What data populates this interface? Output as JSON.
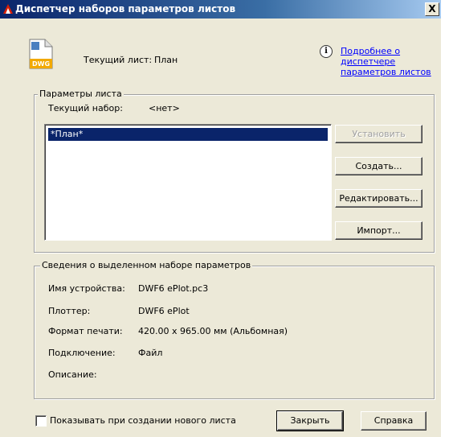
{
  "window": {
    "title": "Диспетчер наборов параметров листов",
    "close_label": "X"
  },
  "header": {
    "current_sheet_label": "Текущий лист:",
    "current_sheet_value": "План",
    "icon_badge": "DWG",
    "info_link_line1": "Подробнее о",
    "info_link_line2": "диспетчере",
    "info_link_line3": "параметров листов"
  },
  "params_group": {
    "legend": "Параметры листа",
    "current_set_label": "Текущий набор:",
    "current_set_value": "<нет>",
    "list_items": [
      "*План*"
    ],
    "buttons": {
      "set": "Установить",
      "create": "Создать...",
      "edit": "Редактировать...",
      "import": "Импорт..."
    }
  },
  "details_group": {
    "legend": "Сведения о выделенном наборе параметров",
    "device_label": "Имя устройства:",
    "device_value": "DWF6 ePlot.pc3",
    "plotter_label": "Плоттер:",
    "plotter_value": "DWF6 ePlot",
    "format_label": "Формат печати:",
    "format_value": "420.00 x 965.00 мм (Альбомная)",
    "connection_label": "Подключение:",
    "connection_value": "Файл",
    "description_label": "Описание:"
  },
  "footer": {
    "checkbox_label": "Показывать при создании нового листа",
    "checkbox_checked": false,
    "close_button": "Закрыть",
    "help_button": "Справка"
  }
}
